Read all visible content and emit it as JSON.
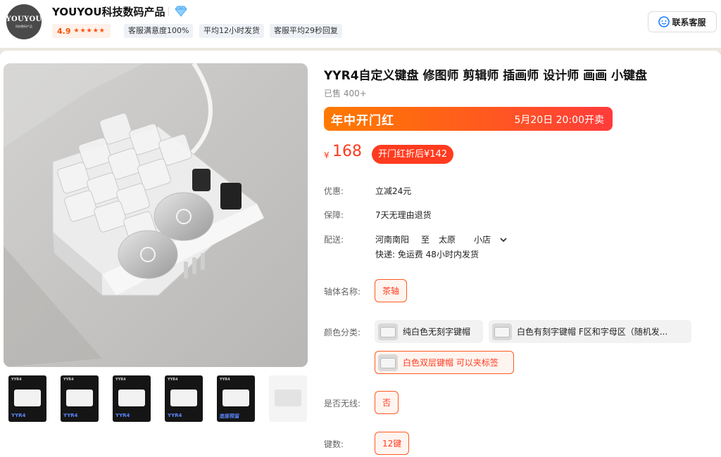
{
  "shop": {
    "logo_text": "YOUYOU",
    "logo_subtext": "科技数码产品",
    "name": "YOUYOU科技数码产品",
    "rating": "4.9",
    "stars": "★★★★★",
    "tags": [
      "客服满意度100%",
      "平均12小时发货",
      "客服平均29秒回复"
    ],
    "contact_label": "联系客服",
    "diamond_icon": "diamond-icon"
  },
  "product": {
    "title": "YYR4自定义键盘 修图师 剪辑师 插画师 设计师 画画 小键盘",
    "sold": "已售 400+",
    "promo_title": "年中开门红",
    "promo_time": "5月20日 20:00开卖",
    "currency": "¥",
    "price": "168",
    "discount_label": "开门红折后¥142",
    "thumbnails": [
      {
        "top": "YYR4",
        "bottom": "YYR4"
      },
      {
        "top": "YYR4",
        "bottom": "YYR4"
      },
      {
        "top": "YYR4",
        "bottom": "YYR4"
      },
      {
        "top": "YYR4",
        "bottom": "YYR4"
      },
      {
        "top": "YYR4",
        "bottom": "底部预留"
      },
      {
        "top": "",
        "bottom": ""
      }
    ]
  },
  "specs": {
    "offer_label": "优惠:",
    "offer_value": "立减24元",
    "guarantee_label": "保障:",
    "guarantee_value": "7天无理由退货",
    "shipping_label": "配送:",
    "shipping_from": "河南南阳",
    "shipping_to_word": "至",
    "shipping_to": "太原",
    "shipping_area": "小店",
    "shipping_detail": "快递: 免运费  48小时内发货",
    "switch_label": "轴体名称:",
    "switch_value": "茶轴",
    "color_label": "颜色分类:",
    "color_options": [
      "纯白色无刻字键帽",
      "白色有刻字键帽 F区和字母区（随机发...",
      "白色双层键帽 可以夹标签"
    ],
    "wireless_label": "是否无线:",
    "wireless_value": "否",
    "keys_label": "键数:",
    "keys_value": "12键"
  },
  "colors": {
    "accent": "#ff3b1f",
    "promo_start": "#ff7a00",
    "promo_end": "#ff3b3b"
  }
}
